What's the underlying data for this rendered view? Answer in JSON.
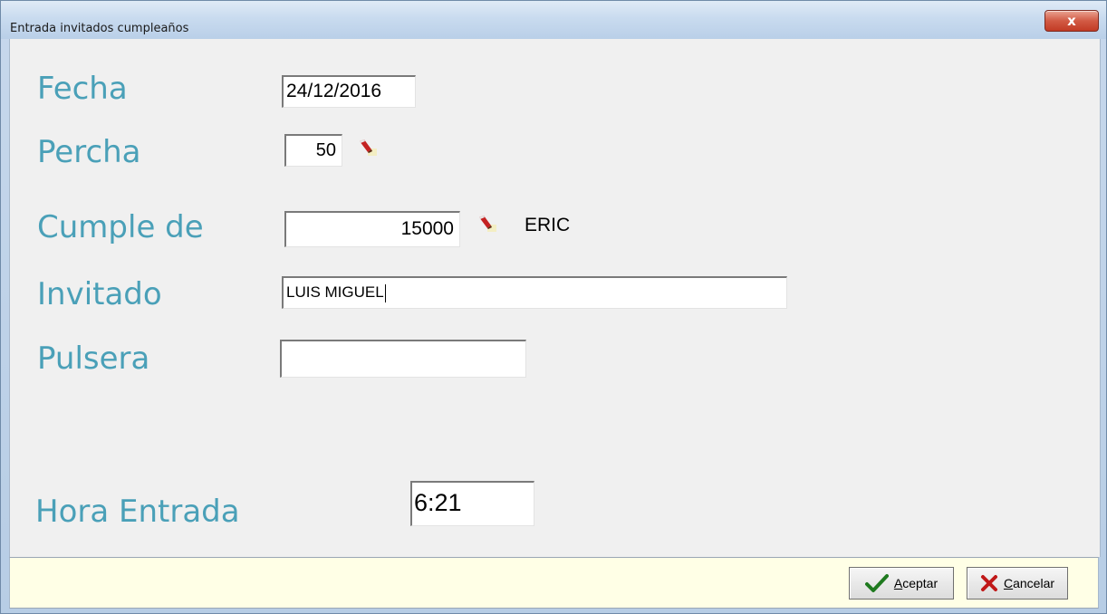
{
  "window": {
    "title": "Entrada invitados cumpleaños",
    "close_label": "x"
  },
  "form": {
    "fecha": {
      "label": "Fecha",
      "value": "24/12/2016"
    },
    "percha": {
      "label": "Percha",
      "value": "50"
    },
    "cumple_de": {
      "label": "Cumple de",
      "value": "15000",
      "name": "ERIC"
    },
    "invitado": {
      "label": "Invitado",
      "value": "LUIS MIGUEL"
    },
    "pulsera": {
      "label": "Pulsera",
      "value": ""
    },
    "hora_entrada": {
      "label": "Hora Entrada",
      "value": "6:21"
    }
  },
  "buttons": {
    "aceptar": {
      "accel": "A",
      "rest": "ceptar"
    },
    "cancelar": {
      "accel": "C",
      "rest": "ancelar"
    }
  },
  "colors": {
    "label": "#4aa0b8",
    "panel": "#f0f0f0",
    "button_bar": "#ffffe6",
    "close": "#c23b25"
  },
  "icons": {
    "lookup": "flashlight-icon",
    "accept": "checkmark-icon",
    "cancel": "x-mark-icon"
  }
}
